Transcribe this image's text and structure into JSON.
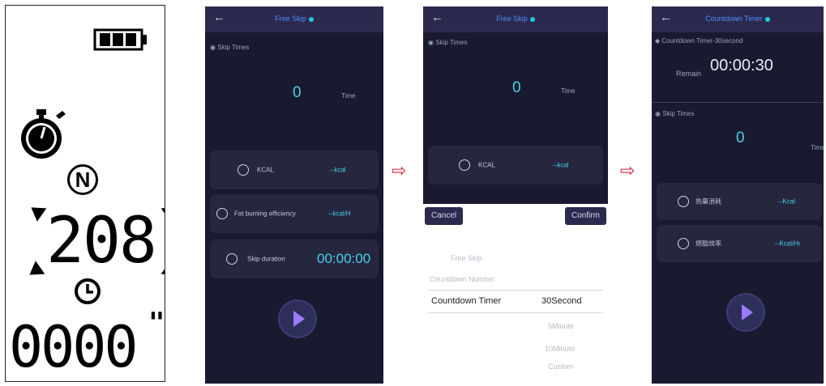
{
  "lcd": {
    "mode_letter": "N",
    "count": "208",
    "time": "0000",
    "time_mark": "\""
  },
  "arrows": [
    "⇨",
    "⇨"
  ],
  "screen1": {
    "title": "Free Skip",
    "section": "Skip Times",
    "count": "0",
    "count_unit": "Time",
    "cards": [
      {
        "label": "KCAL",
        "value": "--kcal"
      },
      {
        "label": "Fat burning efficiency",
        "value": "--kcal/H"
      },
      {
        "label": "Skip duration",
        "value": "00:00:00"
      }
    ]
  },
  "screen2": {
    "title": "Free Skip",
    "section": "Skip Times",
    "count": "0",
    "count_unit": "Time",
    "card_label": "KCAL",
    "card_value": "--kcal",
    "cancel": "Cancel",
    "confirm": "Confirm",
    "left_options": [
      "Free Skip",
      "Countdown Number",
      "Countdown Timer"
    ],
    "right_options": [
      "30Second",
      "5Minute",
      "10Minute",
      "Custom"
    ]
  },
  "screen3": {
    "title": "Countdown Timer",
    "mode_label": "Countdown Timer-30second",
    "remain_label": "Remain",
    "remain_value": "00:00:30",
    "section": "Skip Times",
    "count": "0",
    "count_unit": "Time",
    "cards": [
      {
        "label": "热量消耗",
        "value": "--Kcal"
      },
      {
        "label": "燃脂效率",
        "value": "--Kcal/Hr"
      }
    ]
  },
  "colors": {
    "accent": "#46d2e8",
    "bg": "#191a2f",
    "card": "#26263f",
    "arrow": "#e0233a"
  }
}
